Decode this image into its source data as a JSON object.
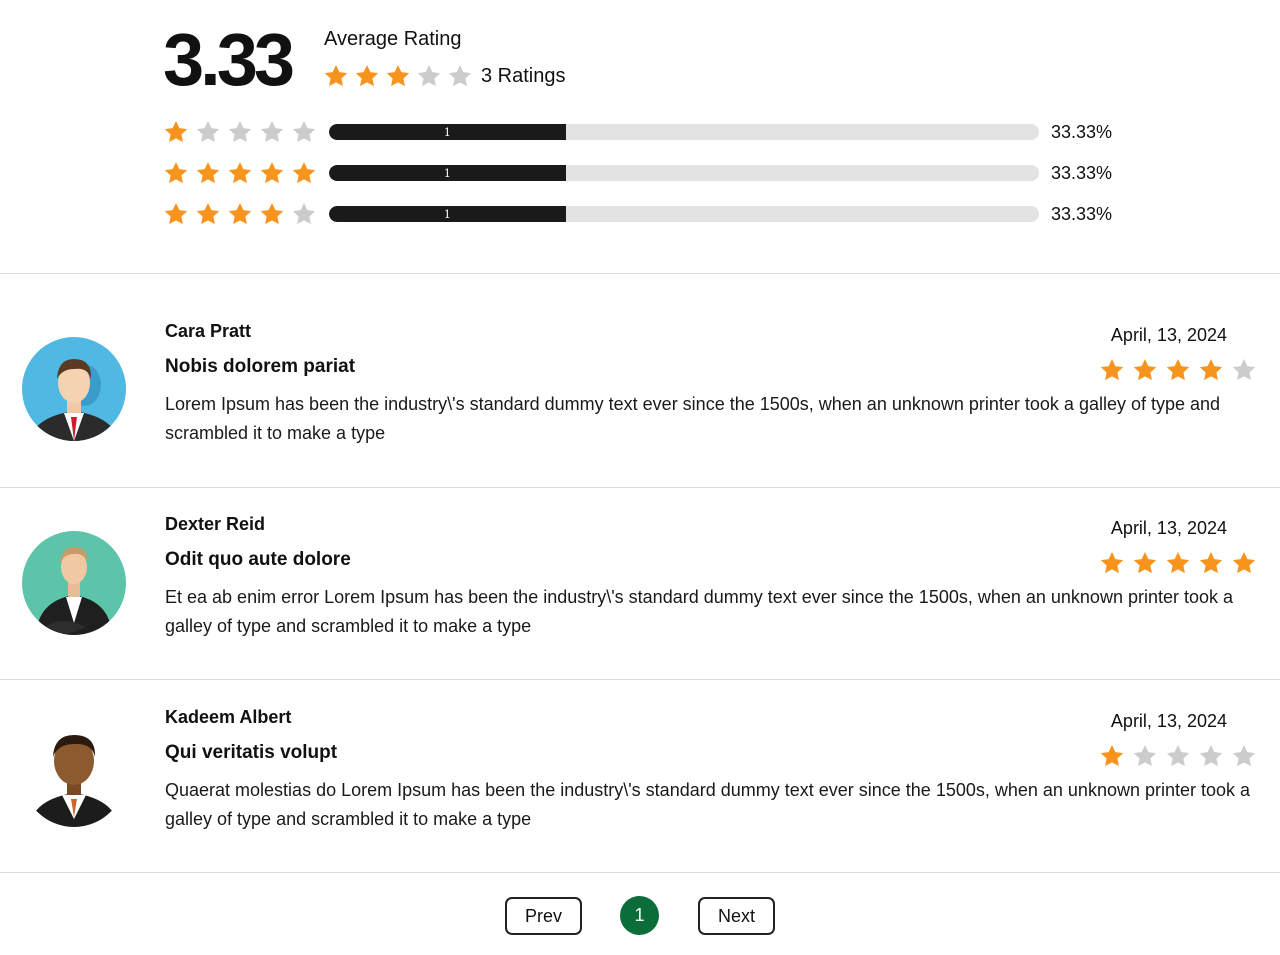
{
  "summary": {
    "average": "3.33",
    "average_label": "Average Rating",
    "average_stars": 3,
    "ratings_count": "3 Ratings",
    "star_color": "#f7941d",
    "empty_star_color": "#cccccc"
  },
  "distribution": [
    {
      "stars": 1,
      "count": "1",
      "percent_label": "33.33%",
      "fill": 0.3333
    },
    {
      "stars": 5,
      "count": "1",
      "percent_label": "33.33%",
      "fill": 0.3333
    },
    {
      "stars": 4,
      "count": "1",
      "percent_label": "33.33%",
      "fill": 0.3333
    }
  ],
  "reviews": [
    {
      "name": "Cara Pratt",
      "title": "Nobis dolorem pariat",
      "text": "Lorem Ipsum has been the industry\\'s standard dummy text ever since the 1500s, when an unknown printer took a galley of type and scrambled it to make a type",
      "date": "April, 13, 2024",
      "stars": 4,
      "avatar": "businessman-avatar-blue"
    },
    {
      "name": "Dexter Reid",
      "title": "Odit quo aute dolore",
      "text": "Et ea ab enim error Lorem Ipsum has been the industry\\'s standard dummy text ever since the 1500s, when an unknown printer took a galley of type and scrambled it to make a type",
      "date": "April, 13, 2024",
      "stars": 5,
      "avatar": "businessman-avatar-green"
    },
    {
      "name": "Kadeem Albert",
      "title": "Qui veritatis volupt",
      "text": "Quaerat molestias do Lorem Ipsum has been the industry\\'s standard dummy text ever since the 1500s, when an unknown printer took a galley of type and scrambled it to make a type",
      "date": "April, 13, 2024",
      "stars": 1,
      "avatar": "businessman-avatar-plain"
    }
  ],
  "pagination": {
    "prev_label": "Prev",
    "current_page": "1",
    "next_label": "Next",
    "active_color": "#0b6e3a"
  }
}
